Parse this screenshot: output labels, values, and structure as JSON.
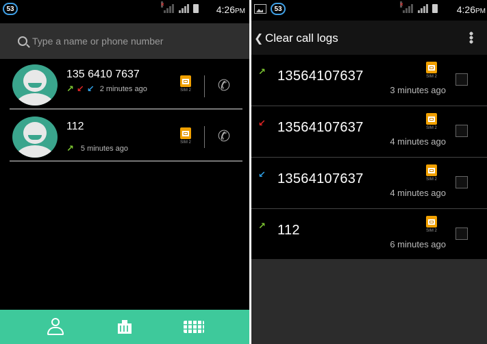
{
  "left": {
    "status": {
      "badge": "53",
      "time": "4:26",
      "ampm": "PM"
    },
    "search": {
      "placeholder": "Type a name or phone number"
    },
    "contacts": [
      {
        "name": "135 6410 7637",
        "time": "2 minutes ago",
        "arrows": [
          "outgoing",
          "missed",
          "incoming"
        ],
        "sim": "SIM 2"
      },
      {
        "name": "112",
        "time": "5 minutes ago",
        "arrows": [
          "outgoing"
        ],
        "sim": "SIM 2"
      }
    ],
    "nav": [
      "contacts-icon",
      "building-icon",
      "keypad-icon"
    ]
  },
  "right": {
    "status": {
      "badge": "53",
      "time": "4:26",
      "ampm": "PM"
    },
    "title": "Clear call logs",
    "logs": [
      {
        "number": "13564107637",
        "time": "3 minutes ago",
        "type": "outgoing",
        "sim": "SIM 2"
      },
      {
        "number": "13564107637",
        "time": "4 minutes ago",
        "type": "missed",
        "sim": "SIM 2"
      },
      {
        "number": "13564107637",
        "time": "4 minutes ago",
        "type": "incoming",
        "sim": "SIM 2"
      },
      {
        "number": "112",
        "time": "6 minutes ago",
        "type": "outgoing",
        "sim": "SIM 2"
      }
    ]
  },
  "colors": {
    "accent": "#3ec99b",
    "outgoing": "#7ec832",
    "missed": "#e02424",
    "incoming": "#2fa0e6",
    "sim": "#f0a000"
  }
}
